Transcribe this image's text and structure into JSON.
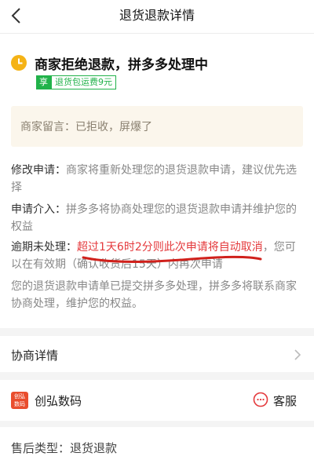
{
  "nav": {
    "title": "退货退款详情"
  },
  "status": {
    "title": "商家拒绝退款，拼多多处理中"
  },
  "badge": {
    "tag": "享",
    "text": "退货包运费9元"
  },
  "memo": {
    "text": "商家留言：已拒收，屏爆了"
  },
  "info": {
    "modify": {
      "key": "修改申请：",
      "text": "商家将重新处理您的退货退款申请，建议优先选择"
    },
    "intervene": {
      "key": "申请介入：",
      "text": "拼多多将协商处理您的退货退款申请并维护您的权益"
    },
    "overdue": {
      "key": "逾期未处理：",
      "highlight": "超过1天6时2分则此次申请将自动取消",
      "rest": "，您可以在有效期（确认收货后15天）内再次申请"
    },
    "note": "您的退货退款申请单已提交拼多多处理，拼多多将联系商家协商处理，维护您的权益。"
  },
  "negotiation": {
    "label": "协商详情"
  },
  "shop": {
    "logo_line1": "创弘",
    "logo_line2": "数码",
    "name": "创弘数码",
    "service_label": "客服"
  },
  "aftersale": {
    "label": "售后类型：退货退款"
  },
  "colors": {
    "brand_red": "#e4393c",
    "badge_green": "#21b24a",
    "clock_yellow": "#f5b316",
    "memo_bg": "#fbf6ec"
  }
}
